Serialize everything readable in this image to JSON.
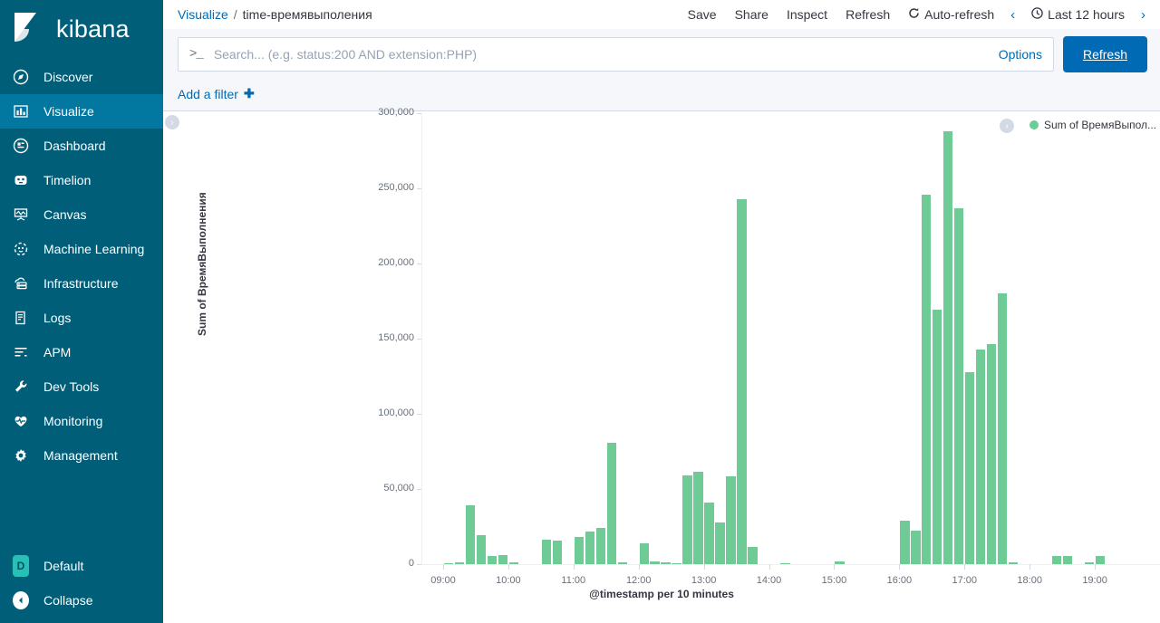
{
  "brand": {
    "name": "kibana",
    "logo_icon": "kibana-logo-icon"
  },
  "sidebar": {
    "items": [
      {
        "label": "Discover",
        "icon": "compass-icon",
        "active": false
      },
      {
        "label": "Visualize",
        "icon": "bar-chart-icon",
        "active": true
      },
      {
        "label": "Dashboard",
        "icon": "dashboard-icon",
        "active": false
      },
      {
        "label": "Timelion",
        "icon": "timelion-icon",
        "active": false
      },
      {
        "label": "Canvas",
        "icon": "canvas-icon",
        "active": false
      },
      {
        "label": "Machine Learning",
        "icon": "machine-learning-icon",
        "active": false
      },
      {
        "label": "Infrastructure",
        "icon": "infrastructure-icon",
        "active": false
      },
      {
        "label": "Logs",
        "icon": "logs-icon",
        "active": false
      },
      {
        "label": "APM",
        "icon": "apm-icon",
        "active": false
      },
      {
        "label": "Dev Tools",
        "icon": "wrench-icon",
        "active": false
      },
      {
        "label": "Monitoring",
        "icon": "heart-pulse-icon",
        "active": false
      },
      {
        "label": "Management",
        "icon": "gear-icon",
        "active": false
      }
    ],
    "space": {
      "initial": "D",
      "label": "Default",
      "color": "#27c0b4"
    },
    "collapse": {
      "label": "Collapse",
      "icon": "arrow-left-circle-icon"
    }
  },
  "topbar": {
    "breadcrumb": {
      "root": "Visualize",
      "separator": "/",
      "current": "time-времявыполения"
    },
    "actions": [
      {
        "label": "Save",
        "icon": null
      },
      {
        "label": "Share",
        "icon": null
      },
      {
        "label": "Inspect",
        "icon": null
      },
      {
        "label": "Refresh",
        "icon": null
      },
      {
        "label": "Auto-refresh",
        "icon": "refresh-cycle-icon"
      }
    ],
    "prev_arrow": "‹",
    "next_arrow": "›",
    "time_picker": {
      "label": "Last 12 hours",
      "icon": "clock-icon"
    }
  },
  "query": {
    "prompt_glyph": ">_",
    "placeholder": "Search... (e.g. status:200 AND extension:PHP)",
    "value": "",
    "options_label": "Options",
    "refresh_label": "Refresh"
  },
  "filters": {
    "add_label": "Add a filter",
    "plus_glyph": "✚"
  },
  "chart_panel": {
    "left_toggle_icon": "chevron-right-circle-icon",
    "legend_toggle_icon": "chevron-right-circle-icon",
    "legend_label": "Sum of ВремяВыпол...",
    "legend_color": "#6ecb95"
  },
  "chart_data": {
    "type": "bar",
    "title": "",
    "xlabel": "@timestamp per 10 minutes",
    "ylabel": "Sum of ВремяВыполнения",
    "ylim": [
      0,
      300000
    ],
    "ytick_labels": [
      "0",
      "50,000",
      "100,000",
      "150,000",
      "200,000",
      "250,000",
      "300,000"
    ],
    "ytick_values": [
      0,
      50000,
      100000,
      150000,
      200000,
      250000,
      300000
    ],
    "xtick_labels": [
      "09:00",
      "10:00",
      "11:00",
      "12:00",
      "13:00",
      "14:00",
      "15:00",
      "16:00",
      "17:00",
      "18:00",
      "19:00"
    ],
    "xlim_minutes": [
      520,
      1190
    ],
    "grid": false,
    "legend_position": "top-right",
    "series_name": "Sum of ВремяВыполнения",
    "color": "#6ecb95",
    "bin_minutes": 10,
    "categories": [
      "08:40",
      "08:50",
      "09:00",
      "09:10",
      "09:20",
      "09:30",
      "09:40",
      "09:50",
      "10:00",
      "10:10",
      "10:20",
      "10:30",
      "10:40",
      "10:50",
      "11:00",
      "11:10",
      "11:20",
      "11:30",
      "11:40",
      "11:50",
      "12:00",
      "12:10",
      "12:20",
      "12:30",
      "12:40",
      "12:50",
      "13:00",
      "13:10",
      "13:20",
      "13:30",
      "13:40",
      "13:50",
      "14:00",
      "14:10",
      "14:20",
      "14:30",
      "14:40",
      "14:50",
      "15:00",
      "15:10",
      "15:20",
      "15:30",
      "15:40",
      "15:50",
      "16:00",
      "16:10",
      "16:20",
      "16:30",
      "16:40",
      "16:50",
      "17:00",
      "17:10",
      "17:20",
      "17:30",
      "17:40",
      "17:50",
      "18:00",
      "18:10",
      "18:20",
      "18:30",
      "18:40",
      "18:50",
      "19:00",
      "19:10",
      "19:20",
      "19:30",
      "19:40",
      "19:50"
    ],
    "values": [
      0,
      0,
      900,
      1200,
      39000,
      19000,
      5500,
      6000,
      1000,
      0,
      0,
      16000,
      15500,
      0,
      18000,
      21500,
      24000,
      80500,
      1200,
      0,
      14000,
      1700,
      1200,
      900,
      59000,
      61500,
      41000,
      27500,
      58500,
      243000,
      11500,
      0,
      0,
      700,
      0,
      0,
      0,
      0,
      2000,
      0,
      0,
      0,
      0,
      0,
      29000,
      22500,
      246000,
      169000,
      288000,
      237000,
      127500,
      142500,
      146500,
      180000,
      1000,
      0,
      0,
      0,
      5500,
      5500,
      0,
      1000,
      5500,
      0,
      0,
      0,
      0,
      0
    ]
  }
}
